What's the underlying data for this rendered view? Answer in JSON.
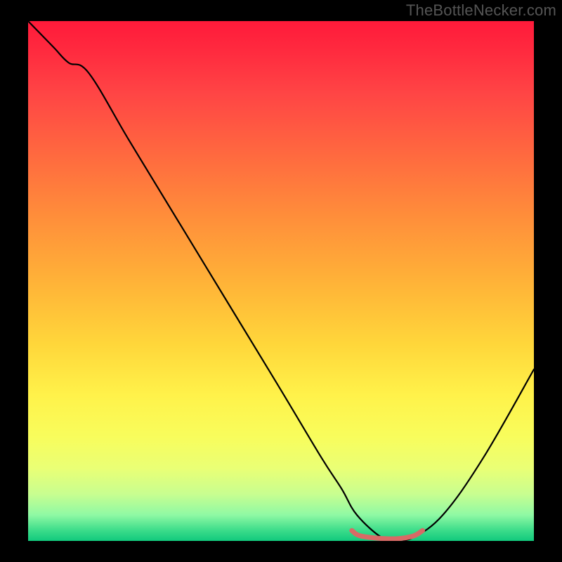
{
  "watermark": "TheBottleNecker.com",
  "chart_data": {
    "type": "line",
    "title": "",
    "xlabel": "",
    "ylabel": "",
    "xlim": [
      0,
      100
    ],
    "ylim": [
      0,
      100
    ],
    "series": [
      {
        "name": "curve",
        "x": [
          0,
          5,
          8,
          12,
          20,
          30,
          40,
          50,
          58,
          62,
          65,
          70,
          73,
          76,
          82,
          90,
          100
        ],
        "y": [
          100,
          95,
          92,
          90,
          77,
          61,
          45,
          29,
          16,
          10,
          5,
          0.6,
          0.3,
          0.6,
          5,
          16,
          33
        ]
      },
      {
        "name": "trough-highlight",
        "x": [
          64,
          66,
          72,
          76,
          78
        ],
        "y": [
          2,
          0.9,
          0.4,
          0.9,
          2
        ]
      }
    ],
    "colors": {
      "curve": "#000000",
      "trough_highlight": "#d86a66"
    }
  }
}
